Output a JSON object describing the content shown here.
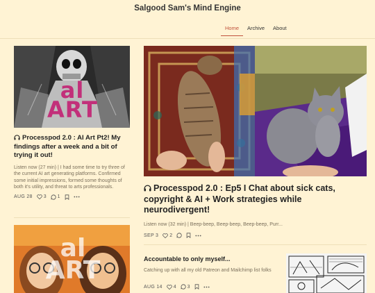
{
  "site": {
    "title": "Salgood Sam's Mind Engine"
  },
  "nav": [
    {
      "label": "Home",
      "active": true
    },
    {
      "label": "Archive"
    },
    {
      "label": "About"
    }
  ],
  "posts": [
    {
      "title": "Processpod 2.0 : AI Art Pt2! My findings after a week and a bit of trying it out!",
      "snippet": "Listen now (27 min) | I had some time to try three of the current AI art generating platforms. Confirmed some initial impressions, formed some thoughts of both it's utility, and threat to arts professionals.",
      "date": "AUG 28",
      "likes": "3",
      "comments": "1",
      "thumb_text": "al ART"
    },
    {
      "title": "Processpod 2.0 : Ep5 I Chat about sick cats, copyright & AI + Work strategies while neurodivergent!",
      "snippet": "Listen now (32 min) | Beep-beep, Beep-beep, Beep-beep, Purr...",
      "date": "SEP 3",
      "likes": "2"
    },
    {
      "title": "Accountable to only myself...",
      "snippet": "Catching up with all my old Patreon and Mailchimp list folks",
      "date": "AUG 14",
      "likes": "4",
      "comments": "3"
    },
    {
      "thumb_text": "al ART"
    }
  ],
  "colors": {
    "accent": "#c0503a",
    "background": "#fff3d4",
    "art_pink": "#c2307a"
  },
  "icons": [
    "headphones-icon",
    "heart-icon",
    "comment-icon",
    "bookmark-icon",
    "more-icon"
  ]
}
